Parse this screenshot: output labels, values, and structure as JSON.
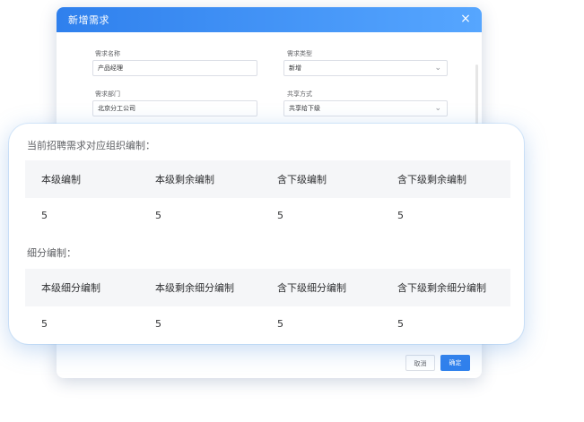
{
  "dialog": {
    "title": "新增需求",
    "close_icon": "×",
    "fields": {
      "requirement_name": {
        "label": "需求名称",
        "value": "产品经理"
      },
      "requirement_type": {
        "label": "需求类型",
        "value": "新增"
      },
      "requirement_dept": {
        "label": "需求部门",
        "value": "北京分工公司"
      },
      "share_method": {
        "label": "共享方式",
        "value": "共享给下级"
      }
    },
    "cancel_label": "取消",
    "ok_label": "确定"
  },
  "overlay": {
    "section1_title": "当前招聘需求对应组织编制：",
    "table1": {
      "headers": [
        "本级编制",
        "本级剩余编制",
        "含下级编制",
        "含下级剩余编制"
      ],
      "row": [
        "5",
        "5",
        "5",
        "5"
      ]
    },
    "section2_title": "细分编制：",
    "table2": {
      "headers": [
        "本级细分编制",
        "本级剩余细分编制",
        "含下级细分编制",
        "含下级剩余细分编制"
      ],
      "row": [
        "5",
        "5",
        "5",
        "5"
      ]
    }
  },
  "icons": {
    "chevron": "chevron-down-icon",
    "close": "close-icon"
  },
  "colors": {
    "header_blue": "#2f80ed",
    "primary_button": "#2f80ed",
    "table_header_bg": "#f5f6f8"
  }
}
